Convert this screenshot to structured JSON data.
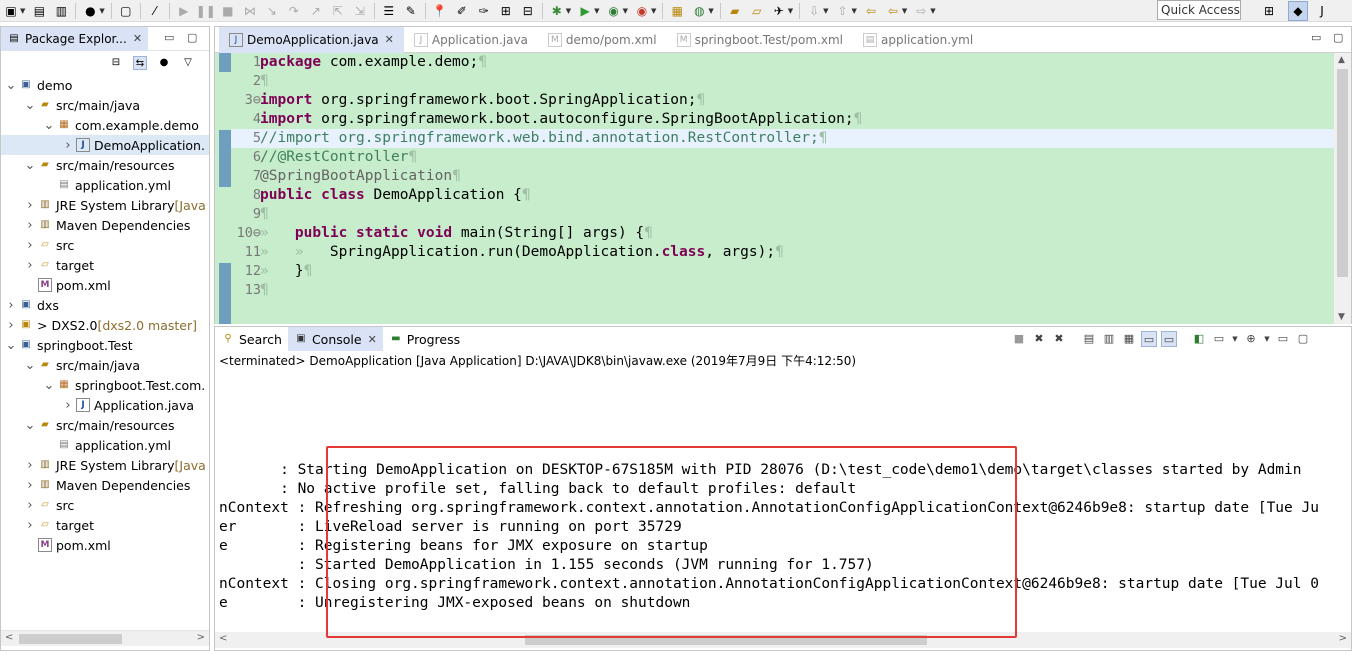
{
  "toolbar": {
    "quick_access_label": "Quick Access"
  },
  "package_explorer": {
    "tab_label": "Package Explor...",
    "tree": [
      {
        "indent": 0,
        "twisty": "open",
        "icon": "project-icon",
        "label": "demo",
        "decor": "",
        "selected": false
      },
      {
        "indent": 1,
        "twisty": "open",
        "icon": "source-folder-icon",
        "label": "src/main/java",
        "decor": "",
        "selected": false
      },
      {
        "indent": 2,
        "twisty": "open",
        "icon": "package-icon",
        "label": "com.example.demo",
        "decor": "",
        "selected": false
      },
      {
        "indent": 3,
        "twisty": "closed",
        "icon": "java-file-icon",
        "label": "DemoApplication.",
        "decor": "",
        "selected": true
      },
      {
        "indent": 1,
        "twisty": "open",
        "icon": "source-folder-icon",
        "label": "src/main/resources",
        "decor": "",
        "selected": false
      },
      {
        "indent": 2,
        "twisty": "none",
        "icon": "file-icon",
        "label": "application.yml",
        "decor": "",
        "selected": false
      },
      {
        "indent": 1,
        "twisty": "closed",
        "icon": "library-icon",
        "label": "JRE System Library",
        "decor": " [Java",
        "selected": false
      },
      {
        "indent": 1,
        "twisty": "closed",
        "icon": "library-icon",
        "label": "Maven Dependencies",
        "decor": "",
        "selected": false
      },
      {
        "indent": 1,
        "twisty": "closed",
        "icon": "folder-icon",
        "label": "src",
        "decor": "",
        "selected": false
      },
      {
        "indent": 1,
        "twisty": "closed",
        "icon": "folder-icon",
        "label": "target",
        "decor": "",
        "selected": false
      },
      {
        "indent": 1,
        "twisty": "none",
        "icon": "maven-file-icon",
        "label": "pom.xml",
        "decor": "",
        "selected": false
      },
      {
        "indent": 0,
        "twisty": "closed",
        "icon": "project-icon",
        "label": "dxs",
        "decor": "",
        "selected": false
      },
      {
        "indent": 0,
        "twisty": "closed",
        "icon": "git-project-icon",
        "label": "> DXS2.0",
        "decor": " [dxs2.0 master]",
        "selected": false
      },
      {
        "indent": 0,
        "twisty": "open",
        "icon": "project-icon",
        "label": "springboot.Test",
        "decor": "",
        "selected": false
      },
      {
        "indent": 1,
        "twisty": "open",
        "icon": "source-folder-icon",
        "label": "src/main/java",
        "decor": "",
        "selected": false
      },
      {
        "indent": 2,
        "twisty": "open",
        "icon": "package-icon",
        "label": "springboot.Test.com.",
        "decor": "",
        "selected": false
      },
      {
        "indent": 3,
        "twisty": "closed",
        "icon": "java-file-icon",
        "label": "Application.java",
        "decor": "",
        "selected": false
      },
      {
        "indent": 1,
        "twisty": "open",
        "icon": "source-folder-icon",
        "label": "src/main/resources",
        "decor": "",
        "selected": false
      },
      {
        "indent": 2,
        "twisty": "none",
        "icon": "file-icon",
        "label": "application.yml",
        "decor": "",
        "selected": false
      },
      {
        "indent": 1,
        "twisty": "closed",
        "icon": "library-icon",
        "label": "JRE System Library",
        "decor": " [Java",
        "selected": false
      },
      {
        "indent": 1,
        "twisty": "closed",
        "icon": "library-icon",
        "label": "Maven Dependencies",
        "decor": "",
        "selected": false
      },
      {
        "indent": 1,
        "twisty": "closed",
        "icon": "folder-icon",
        "label": "src",
        "decor": "",
        "selected": false
      },
      {
        "indent": 1,
        "twisty": "closed",
        "icon": "folder-icon",
        "label": "target",
        "decor": "",
        "selected": false
      },
      {
        "indent": 1,
        "twisty": "none",
        "icon": "maven-file-icon",
        "label": "pom.xml",
        "decor": "",
        "selected": false
      }
    ]
  },
  "editor": {
    "tabs": [
      {
        "label": "DemoApplication.java",
        "active": true,
        "closable": true,
        "icon": "java-file-icon"
      },
      {
        "label": "Application.java",
        "active": false,
        "closable": false,
        "icon": "java-file-icon"
      },
      {
        "label": "demo/pom.xml",
        "active": false,
        "closable": false,
        "icon": "maven-file-icon"
      },
      {
        "label": "springboot.Test/pom.xml",
        "active": false,
        "closable": false,
        "icon": "maven-file-icon"
      },
      {
        "label": "application.yml",
        "active": false,
        "closable": false,
        "icon": "file-icon"
      }
    ],
    "current_line": 5,
    "lines": [
      {
        "n": "1",
        "html_tokens": [
          [
            "kw",
            "package"
          ],
          [
            "t",
            " com.example.demo;"
          ],
          [
            "p",
            "¶"
          ]
        ]
      },
      {
        "n": "2",
        "html_tokens": [
          [
            "p",
            "¶"
          ]
        ]
      },
      {
        "n": "3⊖",
        "html_tokens": [
          [
            "kw",
            "import"
          ],
          [
            "t",
            " org.springframework.boot.SpringApplication;"
          ],
          [
            "p",
            "¶"
          ]
        ]
      },
      {
        "n": "4",
        "html_tokens": [
          [
            "kw",
            "import"
          ],
          [
            "t",
            " org.springframework.boot.autoconfigure.SpringBootApplication;"
          ],
          [
            "p",
            "¶"
          ]
        ]
      },
      {
        "n": "5",
        "html_tokens": [
          [
            "cm",
            "//import org.springframework.web.bind.annotation.RestController;"
          ],
          [
            "p",
            "¶"
          ]
        ]
      },
      {
        "n": "6",
        "html_tokens": [
          [
            "cm",
            "//@RestController"
          ],
          [
            "p",
            "¶"
          ]
        ]
      },
      {
        "n": "7",
        "html_tokens": [
          [
            "an",
            "@SpringBootApplication"
          ],
          [
            "p",
            "¶"
          ]
        ]
      },
      {
        "n": "8",
        "html_tokens": [
          [
            "kw",
            "public"
          ],
          [
            "t",
            " "
          ],
          [
            "kw",
            "class"
          ],
          [
            "t",
            " DemoApplication {"
          ],
          [
            "p",
            "¶"
          ]
        ]
      },
      {
        "n": "9",
        "html_tokens": [
          [
            "p",
            "¶"
          ]
        ]
      },
      {
        "n": "10⊖",
        "html_tokens": [
          [
            "p",
            "»   "
          ],
          [
            "kw",
            "public"
          ],
          [
            "t",
            " "
          ],
          [
            "kw",
            "static"
          ],
          [
            "t",
            " "
          ],
          [
            "kw",
            "void"
          ],
          [
            "t",
            " main(String[] args) {"
          ],
          [
            "p",
            "¶"
          ]
        ]
      },
      {
        "n": "11",
        "html_tokens": [
          [
            "p",
            "»   »   "
          ],
          [
            "t",
            "SpringApplication.run(DemoApplication."
          ],
          [
            "kw",
            "class"
          ],
          [
            "t",
            ", args);"
          ],
          [
            "p",
            "¶"
          ]
        ]
      },
      {
        "n": "12",
        "html_tokens": [
          [
            "p",
            "»   "
          ],
          [
            "t",
            "}"
          ],
          [
            "p",
            "¶"
          ]
        ]
      },
      {
        "n": "13",
        "html_tokens": [
          [
            "p",
            "¶"
          ]
        ]
      }
    ]
  },
  "console": {
    "tabs": [
      {
        "label": "Search",
        "icon": "search-icon",
        "active": false
      },
      {
        "label": "Console",
        "icon": "console-icon",
        "active": true
      },
      {
        "label": "Progress",
        "icon": "progress-icon",
        "active": false
      }
    ],
    "status": "<terminated> DemoApplication [Java Application] D:\\JAVA\\JDK8\\bin\\javaw.exe (2019年7月9日 下午4:12:50)",
    "lines": [
      "       : Starting DemoApplication on DESKTOP-67S185M with PID 28076 (D:\\test_code\\demo1\\demo\\target\\classes started by Admin",
      "       : No active profile set, falling back to default profiles: default",
      "nContext : Refreshing org.springframework.context.annotation.AnnotationConfigApplicationContext@6246b9e8: startup date [Tue Ju",
      "er       : LiveReload server is running on port 35729",
      "e        : Registering beans for JMX exposure on startup",
      "         : Started DemoApplication in 1.155 seconds (JVM running for 1.757)",
      "nContext : Closing org.springframework.context.annotation.AnnotationConfigApplicationContext@6246b9e8: startup date [Tue Jul 0",
      "e        : Unregistering JMX-exposed beans on shutdown"
    ]
  }
}
